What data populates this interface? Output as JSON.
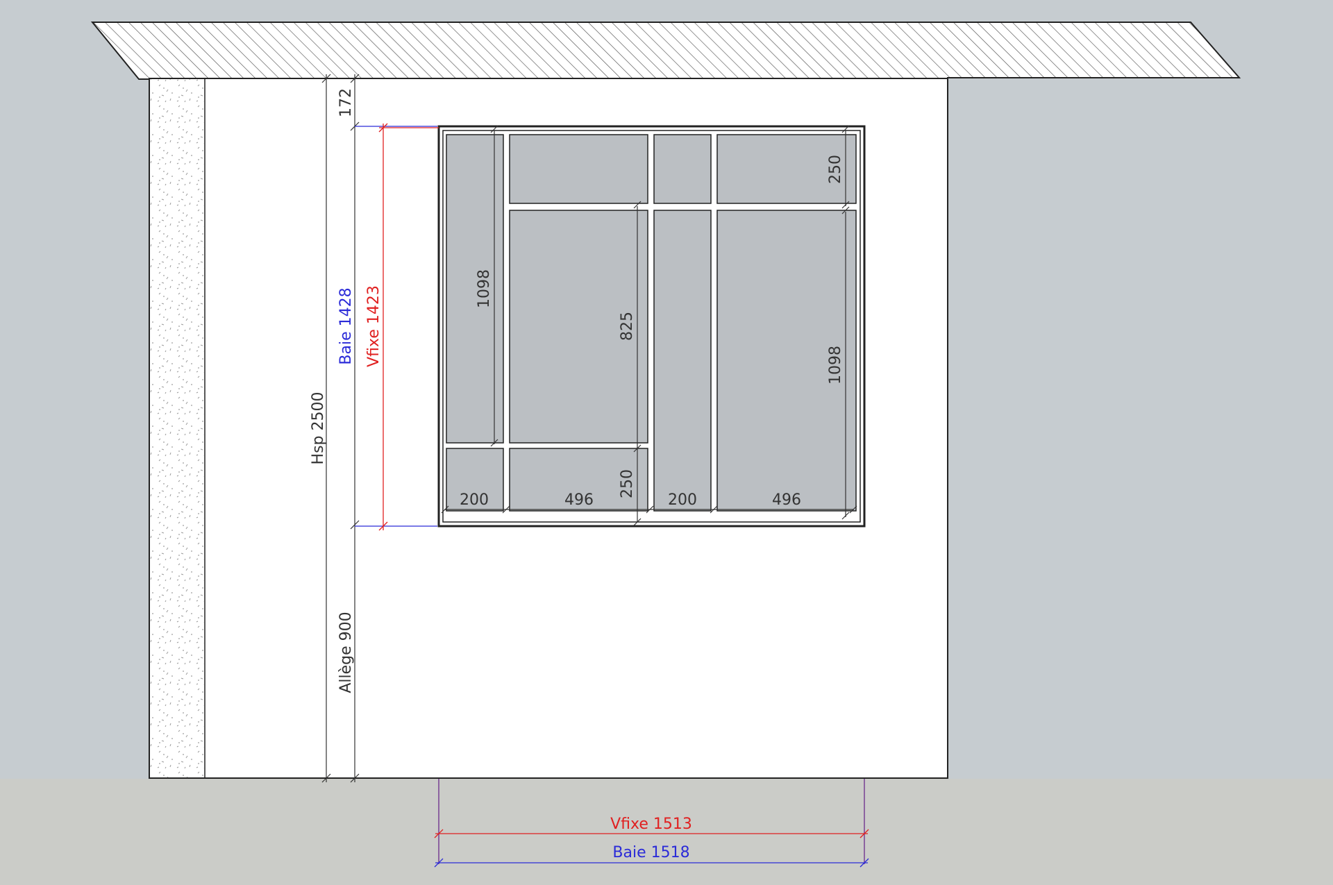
{
  "colors": {
    "sky": "#c6ccd0",
    "ground": "#cbccc8",
    "wall": "#ffffff",
    "glass": "#bbbfc3",
    "outline": "#222222",
    "dim_black": "#333333",
    "dim_blue": "#2b2bd8",
    "dim_red": "#e02020"
  },
  "icons": [
    "hatched-ceiling-slab",
    "speckled-insulation-column"
  ],
  "labels": {
    "hsp": "Hsp 2500",
    "top_gap": "172",
    "allege": "Allège 900",
    "baie_height": "Baie 1428",
    "vfixe_height": "Vfixe 1423",
    "vfixe_width": "Vfixe 1513",
    "baie_width": "Baie 1518"
  },
  "interior": {
    "left_vertical": "1098",
    "mid_vertical": "825",
    "right_vertical": "1098",
    "top_right": "250",
    "bottom_mid": "250",
    "bottom_widths": [
      "200",
      "496",
      "200",
      "496"
    ]
  }
}
